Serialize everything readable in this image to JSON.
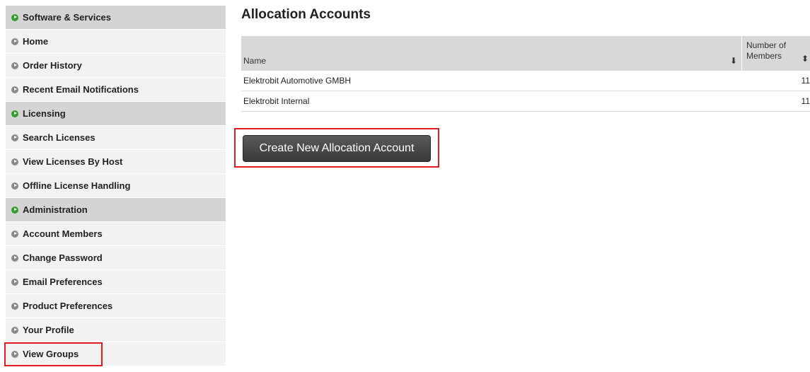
{
  "sidebar": {
    "items": [
      {
        "label": "Software & Services",
        "type": "section"
      },
      {
        "label": "Home",
        "type": "item"
      },
      {
        "label": "Order History",
        "type": "item"
      },
      {
        "label": "Recent Email Notifications",
        "type": "item"
      },
      {
        "label": "Licensing",
        "type": "section"
      },
      {
        "label": "Search Licenses",
        "type": "item"
      },
      {
        "label": "View Licenses By Host",
        "type": "item"
      },
      {
        "label": "Offline License Handling",
        "type": "item"
      },
      {
        "label": "Administration",
        "type": "section"
      },
      {
        "label": "Account Members",
        "type": "item"
      },
      {
        "label": "Change Password",
        "type": "item"
      },
      {
        "label": "Email Preferences",
        "type": "item"
      },
      {
        "label": "Product Preferences",
        "type": "item"
      },
      {
        "label": "Your Profile",
        "type": "item"
      },
      {
        "label": "View Groups",
        "type": "item"
      }
    ]
  },
  "main": {
    "title": "Allocation Accounts",
    "table": {
      "col_name": "Name",
      "col_members_line1": "Number of",
      "col_members_line2": "Members",
      "rows": [
        {
          "name": "Elektrobit Automotive GMBH",
          "members": "11"
        },
        {
          "name": "Elektrobit Internal",
          "members": "11"
        }
      ]
    },
    "create_button": "Create New Allocation Account"
  },
  "colors": {
    "accent_green": "#2fa02f",
    "highlight_red": "#e01b22",
    "button_dark": "#444444"
  }
}
